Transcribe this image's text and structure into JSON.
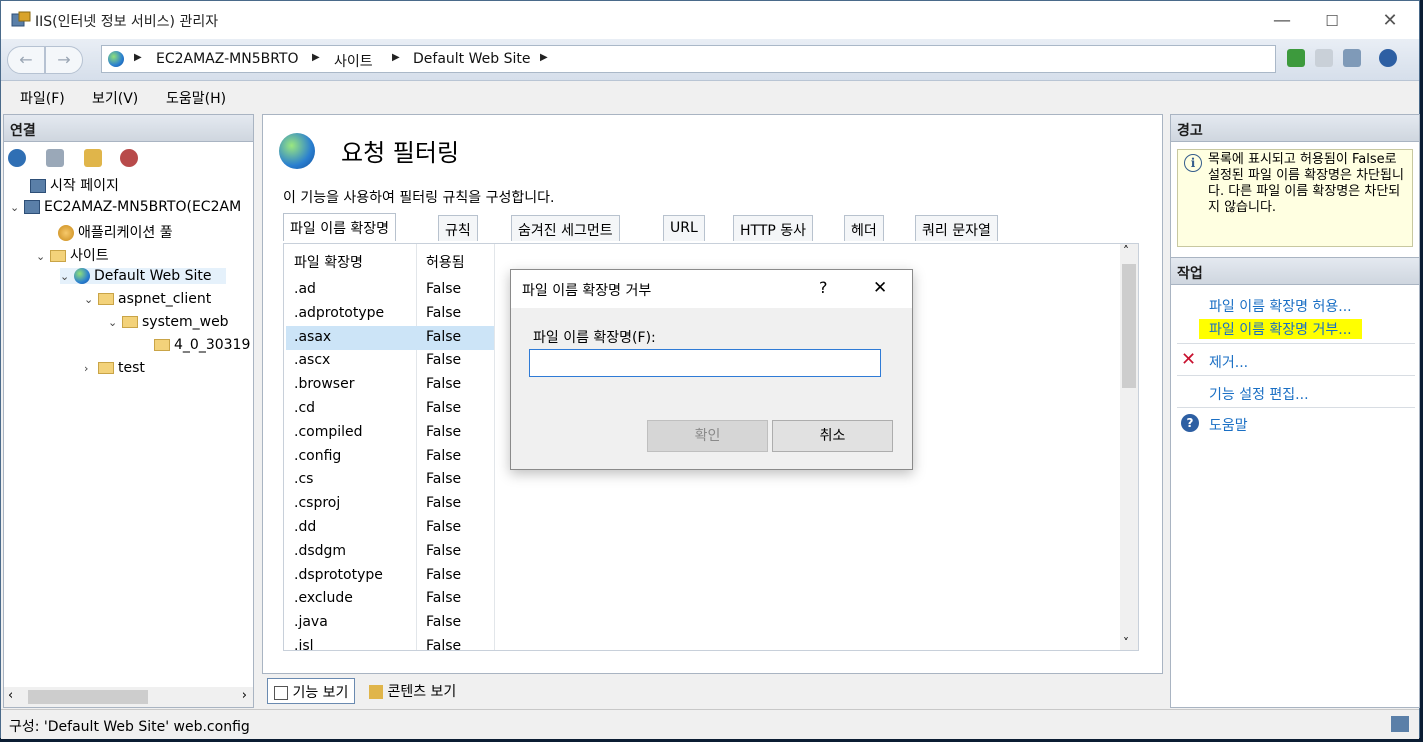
{
  "window": {
    "title": "IIS(인터넷 정보 서비스) 관리자",
    "minimize": "—",
    "maximize": "☐",
    "close": "✕"
  },
  "address": {
    "back": "←",
    "forward": "→",
    "crumbs": [
      "EC2AMAZ-MN5BRTO",
      "사이트",
      "Default Web Site"
    ],
    "separator": "▶"
  },
  "menu": [
    "파일(F)",
    "보기(V)",
    "도움말(H)"
  ],
  "connections": {
    "header": "연결",
    "tree": [
      {
        "label": "시작 페이지"
      },
      {
        "label": "EC2AMAZ-MN5BRTO(EC2AM"
      },
      {
        "label": "애플리케이션 풀"
      },
      {
        "label": "사이트"
      },
      {
        "label": "Default Web Site"
      },
      {
        "label": "aspnet_client"
      },
      {
        "label": "system_web"
      },
      {
        "label": "4_0_30319"
      },
      {
        "label": "test"
      }
    ]
  },
  "center": {
    "title": "요청 필터링",
    "description": "이 기능을 사용하여 필터링 규칙을 구성합니다.",
    "tabs": [
      "파일 이름 확장명",
      "규칙",
      "숨겨진 세그먼트",
      "URL",
      "HTTP 동사",
      "헤더",
      "쿼리 문자열"
    ],
    "columns": [
      "파일 확장명",
      "허용됨"
    ],
    "rows": [
      {
        "ext": ".ad",
        "allowed": "False"
      },
      {
        "ext": ".adprototype",
        "allowed": "False"
      },
      {
        "ext": ".asax",
        "allowed": "False"
      },
      {
        "ext": ".ascx",
        "allowed": "False"
      },
      {
        "ext": ".browser",
        "allowed": "False"
      },
      {
        "ext": ".cd",
        "allowed": "False"
      },
      {
        "ext": ".compiled",
        "allowed": "False"
      },
      {
        "ext": ".config",
        "allowed": "False"
      },
      {
        "ext": ".cs",
        "allowed": "False"
      },
      {
        "ext": ".csproj",
        "allowed": "False"
      },
      {
        "ext": ".dd",
        "allowed": "False"
      },
      {
        "ext": ".dsdgm",
        "allowed": "False"
      },
      {
        "ext": ".dsprototype",
        "allowed": "False"
      },
      {
        "ext": ".exclude",
        "allowed": "False"
      },
      {
        "ext": ".java",
        "allowed": "False"
      },
      {
        "ext": ".jsl",
        "allowed": "False"
      }
    ],
    "selected_row": 2,
    "view_feature": "기능 보기",
    "view_content": "콘텐츠 보기"
  },
  "dialog": {
    "title": "파일 이름 확장명 거부",
    "help": "?",
    "close": "✕",
    "field_label": "파일 이름 확장명(F):",
    "field_value": "",
    "ok": "확인",
    "cancel": "취소"
  },
  "actions": {
    "warning_header": "경고",
    "warning_text": "목록에 표시되고 허용됨이 False로 설정된 파일 이름 확장명은 차단됩니다. 다른 파일 이름 확장명은 차단되지 않습니다.",
    "tasks_header": "작업",
    "allow": "파일 이름 확장명 허용...",
    "deny": "파일 이름 확장명 거부...",
    "remove": "제거...",
    "edit_settings": "기능 설정 편집...",
    "help": "도움말"
  },
  "status": {
    "text": "구성: 'Default Web Site' web.config"
  },
  "colors": {
    "link": "#1a6fc4",
    "highlight": "#ffff00",
    "selection": "#cce4f7"
  }
}
